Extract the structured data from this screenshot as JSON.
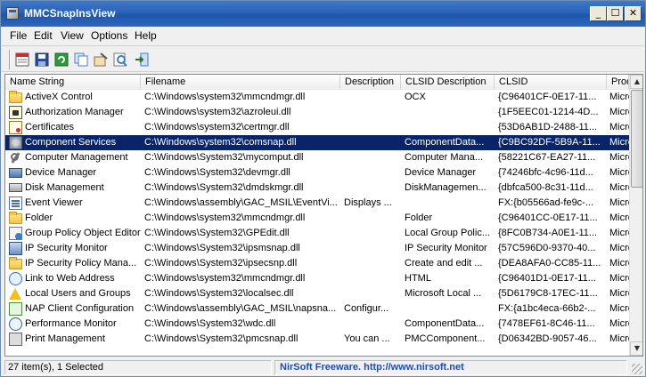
{
  "window": {
    "title": "MMCSnapInsView"
  },
  "menu": [
    "File",
    "Edit",
    "View",
    "Options",
    "Help"
  ],
  "toolbar": {
    "buttons": [
      {
        "name": "save-report-button",
        "icon": "report-icon",
        "color": "#c43030"
      },
      {
        "name": "save-button",
        "icon": "floppy-icon",
        "color": "#2a4d9a"
      },
      {
        "name": "refresh-button",
        "icon": "refresh-icon",
        "color": "#2c9a3a"
      },
      {
        "name": "copy-button",
        "icon": "copy-icon",
        "color": "#4a7fc0"
      },
      {
        "name": "properties-button",
        "icon": "properties-icon",
        "color": "#8a6e3a"
      },
      {
        "name": "find-button",
        "icon": "find-icon",
        "color": "#3a7ec9"
      },
      {
        "name": "exit-button",
        "icon": "exit-icon",
        "color": "#3a7ec9"
      }
    ]
  },
  "columns": [
    "Name String",
    "Filename",
    "Description",
    "CLSID Description",
    "CLSID",
    "Prod"
  ],
  "rows": [
    {
      "icon": "folder-icon",
      "name": "ActiveX Control",
      "file": "C:\\Windows\\system32\\mmcndmgr.dll",
      "desc": "",
      "clsid_desc": "OCX",
      "clsid": "{C96401CF-0E17-11...",
      "prod": "Micro"
    },
    {
      "icon": "authorization-icon",
      "name": "Authorization Manager",
      "file": "C:\\Windows\\system32\\azroleui.dll",
      "desc": "",
      "clsid_desc": "",
      "clsid": "{1F5EEC01-1214-4D...",
      "prod": "Micro"
    },
    {
      "icon": "certificate-icon",
      "name": "Certificates",
      "file": "C:\\Windows\\system32\\certmgr.dll",
      "desc": "",
      "clsid_desc": "",
      "clsid": "{53D6AB1D-2488-11...",
      "prod": "Micro"
    },
    {
      "icon": "component-services-icon",
      "name": "Component Services",
      "file": "C:\\Windows\\system32\\comsnap.dll",
      "desc": "",
      "clsid_desc": "ComponentData...",
      "clsid": "{C9BC92DF-5B9A-11...",
      "prod": "Micro",
      "selected": true
    },
    {
      "icon": "computer-management-icon",
      "name": "Computer Management",
      "file": "C:\\Windows\\System32\\mycomput.dll",
      "desc": "",
      "clsid_desc": "Computer Mana...",
      "clsid": "{58221C67-EA27-11...",
      "prod": "Micro"
    },
    {
      "icon": "device-manager-icon",
      "name": "Device Manager",
      "file": "C:\\Windows\\System32\\devmgr.dll",
      "desc": "",
      "clsid_desc": "Device Manager",
      "clsid": "{74246bfc-4c96-11d...",
      "prod": "Micro"
    },
    {
      "icon": "disk-management-icon",
      "name": "Disk Management",
      "file": "C:\\Windows\\System32\\dmdskmgr.dll",
      "desc": "",
      "clsid_desc": "DiskManagemen...",
      "clsid": "{dbfca500-8c31-11d...",
      "prod": "Micro"
    },
    {
      "icon": "event-viewer-icon",
      "name": "Event Viewer",
      "file": "C:\\Windows\\assembly\\GAC_MSIL\\EventVi...",
      "desc": "Displays ...",
      "clsid_desc": "",
      "clsid": "FX:{b05566ad-fe9c-...",
      "prod": "Micro"
    },
    {
      "icon": "folder-icon",
      "name": "Folder",
      "file": "C:\\Windows\\system32\\mmcndmgr.dll",
      "desc": "",
      "clsid_desc": "Folder",
      "clsid": "{C96401CC-0E17-11...",
      "prod": "Micro"
    },
    {
      "icon": "group-policy-icon",
      "name": "Group Policy Object Editor",
      "file": "C:\\Windows\\System32\\GPEdit.dll",
      "desc": "",
      "clsid_desc": "Local Group Polic...",
      "clsid": "{8FC0B734-A0E1-11...",
      "prod": "Micro"
    },
    {
      "icon": "ip-security-icon",
      "name": "IP Security Monitor",
      "file": "C:\\Windows\\System32\\ipsmsnap.dll",
      "desc": "",
      "clsid_desc": "IP Security Monitor",
      "clsid": "{57C596D0-9370-40...",
      "prod": "Micro"
    },
    {
      "icon": "folder-icon",
      "name": "IP Security Policy Mana...",
      "file": "C:\\Windows\\System32\\ipsecsnp.dll",
      "desc": "",
      "clsid_desc": "Create and edit ...",
      "clsid": "{DEA8AFA0-CC85-11...",
      "prod": "Micro"
    },
    {
      "icon": "link-icon",
      "name": "Link to Web Address",
      "file": "C:\\Windows\\system32\\mmcndmgr.dll",
      "desc": "",
      "clsid_desc": "HTML",
      "clsid": "{C96401D1-0E17-11...",
      "prod": "Micro"
    },
    {
      "icon": "warning-icon",
      "name": "Local Users and Groups",
      "file": "C:\\Windows\\System32\\localsec.dll",
      "desc": "",
      "clsid_desc": "Microsoft Local ...",
      "clsid": "{5D6179C8-17EC-11...",
      "prod": "Micro"
    },
    {
      "icon": "nap-client-icon",
      "name": "NAP Client Configuration",
      "file": "C:\\Windows\\assembly\\GAC_MSIL\\napsna...",
      "desc": "Configur...",
      "clsid_desc": "",
      "clsid": "FX:{a1bc4eca-66b2-...",
      "prod": "Micro"
    },
    {
      "icon": "performance-icon",
      "name": "Performance Monitor",
      "file": "C:\\Windows\\System32\\wdc.dll",
      "desc": "",
      "clsid_desc": "ComponentData...",
      "clsid": "{7478EF61-8C46-11...",
      "prod": "Micro"
    },
    {
      "icon": "print-icon",
      "name": "Print Management",
      "file": "C:\\Windows\\System32\\pmcsnap.dll",
      "desc": "You can ...",
      "clsid_desc": "PMCComponent...",
      "clsid": "{D06342BD-9057-46...",
      "prod": "Micro"
    }
  ],
  "status": {
    "count": "27 item(s), 1 Selected",
    "credit": "NirSoft Freeware.  http://www.nirsoft.net"
  },
  "colors": {
    "selection": "#0a246a",
    "titlebar": "#2a62b8",
    "credit": "#1a4fb0"
  }
}
